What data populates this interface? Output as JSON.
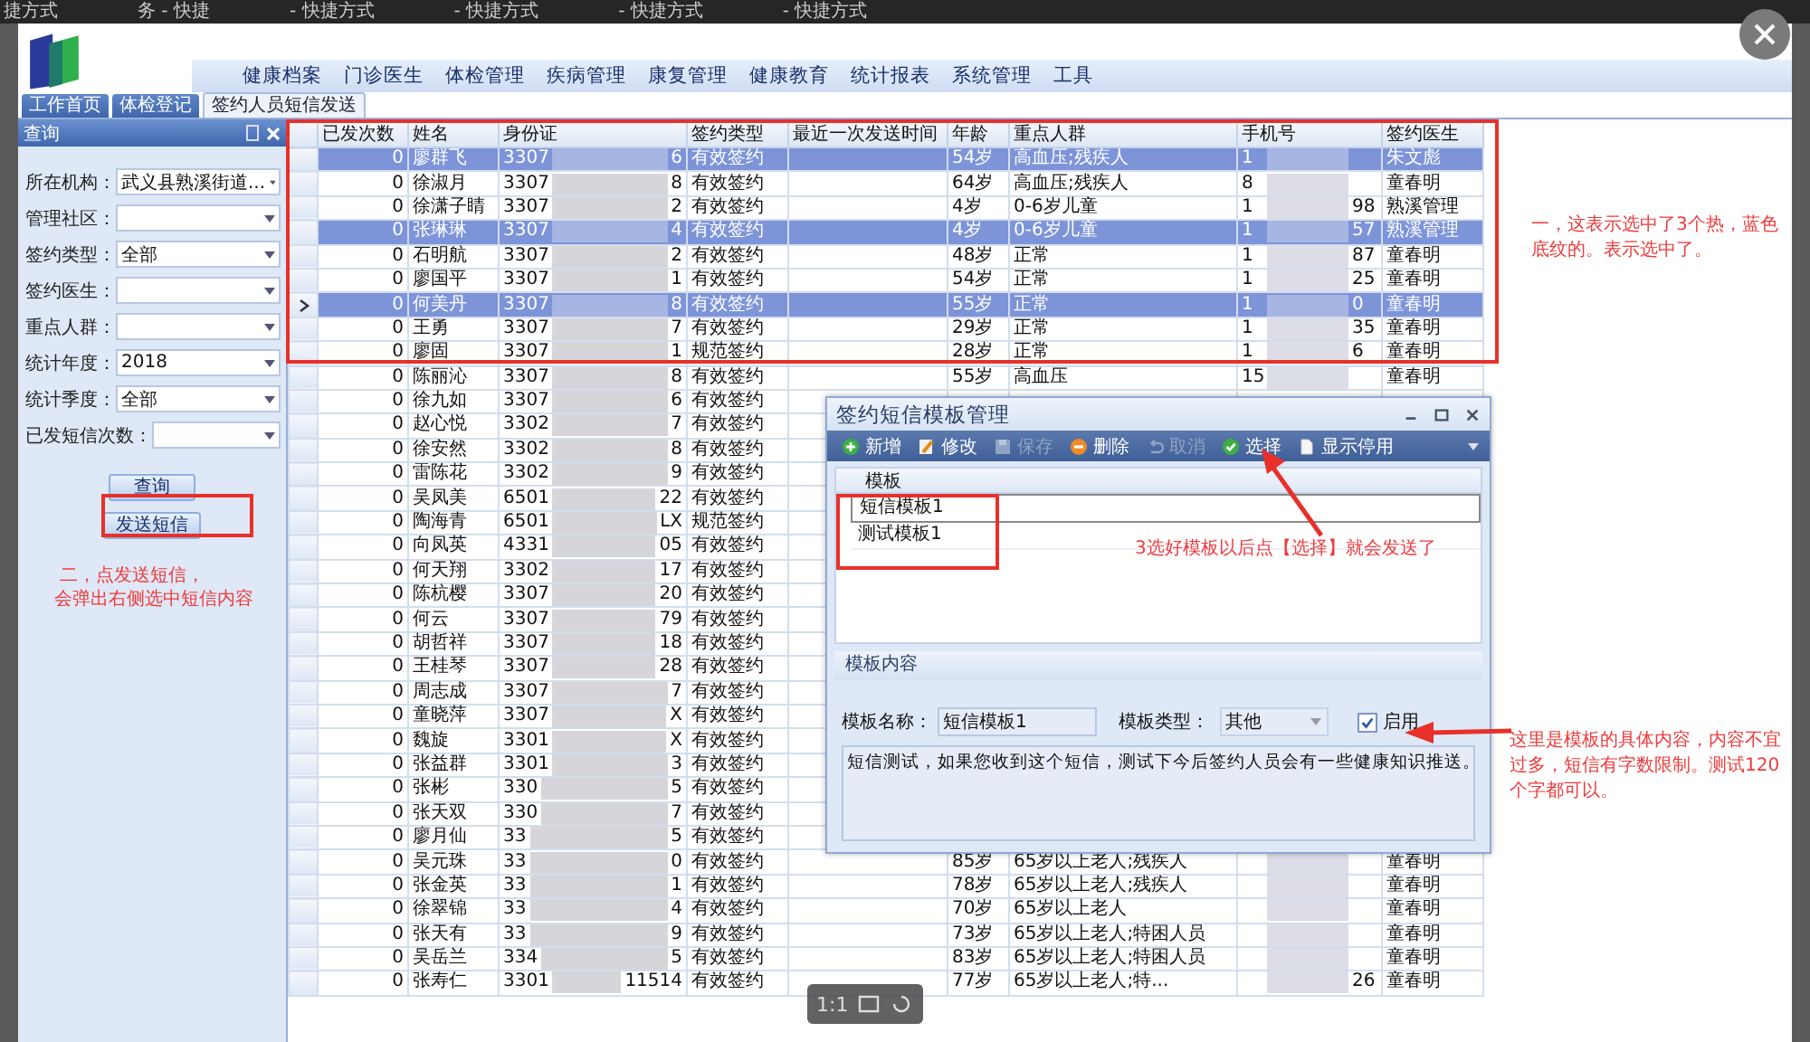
{
  "desktop_strip": [
    "捷方式",
    "务 - 快捷",
    "- 快捷方式",
    "- 快捷方式",
    "- 快捷方式",
    "- 快捷方式"
  ],
  "menu": [
    "健康档案",
    "门诊医生",
    "体检管理",
    "疾病管理",
    "康复管理",
    "健康教育",
    "统计报表",
    "系统管理",
    "工具"
  ],
  "tabs": [
    {
      "label": "工作首页",
      "selected": false
    },
    {
      "label": "体检登记",
      "selected": false
    },
    {
      "label": "签约人员短信发送",
      "selected": true
    }
  ],
  "query_panel": {
    "title": "查询",
    "fields": [
      {
        "label": "所在机构：",
        "value": "武义县熟溪街道..."
      },
      {
        "label": "管理社区："
      },
      {
        "label": "签约类型：",
        "value": "全部"
      },
      {
        "label": "签约医生："
      },
      {
        "label": "重点人群："
      },
      {
        "label": "统计年度：",
        "value": "2018"
      },
      {
        "label": "统计季度：",
        "value": "全部"
      },
      {
        "label": "已发短信次数："
      }
    ],
    "buttons": [
      "查询",
      "发送短信"
    ]
  },
  "table": {
    "columns": [
      "已发次数",
      "姓名",
      "身份证",
      "签约类型",
      "最近一次发送时间",
      "年龄",
      "重点人群",
      "手机号",
      "签约医生"
    ],
    "rows": [
      {
        "sent": "0",
        "name": "廖群飞",
        "id_head": "3307",
        "id_tail": "6",
        "sign_type": "有效签约",
        "age": "54岁",
        "group": "高血压;残疾人",
        "phone_head": "1",
        "doctor": "朱文彪",
        "selected": true,
        "current": false
      },
      {
        "sent": "0",
        "name": "徐淑月",
        "id_head": "3307",
        "id_tail": "8",
        "sign_type": "有效签约",
        "age": "64岁",
        "group": "高血压;残疾人",
        "phone_head": "8",
        "doctor": "童春明",
        "selected": false,
        "current": false
      },
      {
        "sent": "0",
        "name": "徐潇子睛",
        "id_head": "3307",
        "id_tail": "2",
        "sign_type": "有效签约",
        "age": "4岁",
        "group": "0-6岁儿童",
        "phone_head": "1",
        "phone_tail": "98",
        "doctor": "熟溪管理",
        "selected": false,
        "current": false
      },
      {
        "sent": "0",
        "name": "张琳琳",
        "id_head": "3307",
        "id_tail": "4",
        "sign_type": "有效签约",
        "age": "4岁",
        "group": "0-6岁儿童",
        "phone_head": "1",
        "phone_tail": "57",
        "doctor": "熟溪管理",
        "selected": true,
        "current": false
      },
      {
        "sent": "0",
        "name": "石明航",
        "id_head": "3307",
        "id_tail": "2",
        "sign_type": "有效签约",
        "age": "48岁",
        "group": "正常",
        "phone_head": "1",
        "phone_tail": "87",
        "doctor": "童春明",
        "selected": false,
        "current": false
      },
      {
        "sent": "0",
        "name": "廖国平",
        "id_head": "3307",
        "id_tail": "1",
        "sign_type": "有效签约",
        "age": "54岁",
        "group": "正常",
        "phone_head": "1",
        "phone_tail": "25",
        "doctor": "童春明",
        "selected": false,
        "current": false
      },
      {
        "sent": "0",
        "name": "何美丹",
        "id_head": "3307",
        "id_tail": "8",
        "sign_type": "有效签约",
        "age": "55岁",
        "group": "正常",
        "phone_head": "1",
        "phone_tail": "0",
        "doctor": "童春明",
        "selected": true,
        "current": true
      },
      {
        "sent": "0",
        "name": "王勇",
        "id_head": "3307",
        "id_tail": "7",
        "sign_type": "有效签约",
        "age": "29岁",
        "group": "正常",
        "phone_head": "1",
        "phone_tail": "35",
        "doctor": "童春明",
        "selected": false,
        "current": false
      },
      {
        "sent": "0",
        "name": "廖固",
        "id_head": "3307",
        "id_tail": "1",
        "sign_type": "规范签约",
        "age": "28岁",
        "group": "正常",
        "phone_head": "1",
        "phone_tail": "6",
        "doctor": "童春明",
        "selected": false,
        "current": false
      },
      {
        "sent": "0",
        "name": "陈丽沁",
        "id_head": "3307",
        "id_tail": "8",
        "sign_type": "有效签约",
        "age": "55岁",
        "group": "高血压",
        "phone_head": "15",
        "doctor": "童春明",
        "selected": false,
        "current": false
      },
      {
        "sent": "0",
        "name": "徐九如",
        "id_head": "3307",
        "id_tail": "6",
        "sign_type": "有效签约",
        "selected": false,
        "current": false
      },
      {
        "sent": "0",
        "name": "赵心悦",
        "id_head": "3302",
        "id_tail": "7",
        "sign_type": "有效签约",
        "selected": false,
        "current": false
      },
      {
        "sent": "0",
        "name": "徐安然",
        "id_head": "3302",
        "id_tail": "8",
        "sign_type": "有效签约",
        "selected": false,
        "current": false
      },
      {
        "sent": "0",
        "name": "雷陈花",
        "id_head": "3302",
        "id_tail": "9",
        "sign_type": "有效签约",
        "selected": false,
        "current": false
      },
      {
        "sent": "0",
        "name": "吴凤美",
        "id_head": "6501",
        "id_tail": "22",
        "sign_type": "有效签约",
        "selected": false,
        "current": false
      },
      {
        "sent": "0",
        "name": "陶海青",
        "id_head": "6501",
        "id_tail": "LX",
        "sign_type": "规范签约",
        "selected": false,
        "current": false
      },
      {
        "sent": "0",
        "name": "向凤英",
        "id_head": "4331",
        "id_tail": "05",
        "sign_type": "有效签约",
        "selected": false,
        "current": false
      },
      {
        "sent": "0",
        "name": "何天翔",
        "id_head": "3302",
        "id_tail": "17",
        "sign_type": "有效签约",
        "selected": false,
        "current": false
      },
      {
        "sent": "0",
        "name": "陈杭樱",
        "id_head": "3307",
        "id_tail": "20",
        "sign_type": "有效签约",
        "selected": false,
        "current": false
      },
      {
        "sent": "0",
        "name": "何云",
        "id_head": "3307",
        "id_tail": "79",
        "sign_type": "有效签约",
        "selected": false,
        "current": false
      },
      {
        "sent": "0",
        "name": "胡哲祥",
        "id_head": "3307",
        "id_tail": "18",
        "sign_type": "有效签约",
        "selected": false,
        "current": false
      },
      {
        "sent": "0",
        "name": "王桂琴",
        "id_head": "3307",
        "id_tail": "28",
        "sign_type": "有效签约",
        "selected": false,
        "current": false
      },
      {
        "sent": "0",
        "name": "周志成",
        "id_head": "3307",
        "id_tail": "7",
        "sign_type": "有效签约",
        "selected": false,
        "current": false
      },
      {
        "sent": "0",
        "name": "童晓萍",
        "id_head": "3307",
        "id_tail": "X",
        "sign_type": "有效签约",
        "selected": false,
        "current": false
      },
      {
        "sent": "0",
        "name": "魏旋",
        "id_head": "3301",
        "id_tail": "X",
        "sign_type": "有效签约",
        "selected": false,
        "current": false
      },
      {
        "sent": "0",
        "name": "张益群",
        "id_head": "3301",
        "id_tail": "3",
        "sign_type": "有效签约",
        "selected": false,
        "current": false
      },
      {
        "sent": "0",
        "name": "张彬",
        "id_head": "330",
        "id_tail": "5",
        "sign_type": "有效签约",
        "selected": false,
        "current": false
      },
      {
        "sent": "0",
        "name": "张天双",
        "id_head": "330",
        "id_tail": "7",
        "sign_type": "有效签约",
        "selected": false,
        "current": false
      },
      {
        "sent": "0",
        "name": "廖月仙",
        "id_head": "33",
        "id_tail": "5",
        "sign_type": "有效签约",
        "selected": false,
        "current": false
      },
      {
        "sent": "0",
        "name": "吴元珠",
        "id_head": "33",
        "id_tail": "0",
        "sign_type": "有效签约",
        "age": "85岁",
        "group": "65岁以上老人;残疾人",
        "doctor": "童春明",
        "selected": false,
        "current": false
      },
      {
        "sent": "0",
        "name": "张金英",
        "id_head": "33",
        "id_tail": "1",
        "sign_type": "有效签约",
        "age": "78岁",
        "group": "65岁以上老人;残疾人",
        "doctor": "童春明",
        "selected": false,
        "current": false
      },
      {
        "sent": "0",
        "name": "徐翠锦",
        "id_head": "33",
        "id_tail": "4",
        "sign_type": "有效签约",
        "age": "70岁",
        "group": "65岁以上老人",
        "doctor": "童春明",
        "selected": false,
        "current": false
      },
      {
        "sent": "0",
        "name": "张天有",
        "id_head": "33",
        "id_tail": "9",
        "sign_type": "有效签约",
        "age": "73岁",
        "group": "65岁以上老人;特困人员",
        "doctor": "童春明",
        "selected": false,
        "current": false
      },
      {
        "sent": "0",
        "name": "吴岳兰",
        "id_head": "334",
        "id_tail": "5",
        "sign_type": "有效签约",
        "age": "83岁",
        "group": "65岁以上老人;特困人员",
        "doctor": "童春明",
        "selected": false,
        "current": false
      },
      {
        "sent": "0",
        "name": "张寿仁",
        "id_head": "3301",
        "id_tail": "11514",
        "sign_type": "有效签约",
        "age": "77岁",
        "group": "65岁以上老人;特...",
        "phone_tail": "26",
        "doctor": "童春明",
        "selected": false,
        "current": false
      }
    ]
  },
  "dialog": {
    "title": "签约短信模板管理",
    "toolbar": [
      {
        "kind": "add",
        "label": "新增",
        "disabled": false
      },
      {
        "kind": "edit",
        "label": "修改",
        "disabled": false
      },
      {
        "kind": "save",
        "label": "保存",
        "disabled": true
      },
      {
        "kind": "delete",
        "label": "删除",
        "disabled": false
      },
      {
        "kind": "cancel",
        "label": "取消",
        "disabled": true
      },
      {
        "kind": "select",
        "label": "选择",
        "disabled": false
      },
      {
        "kind": "page",
        "label": "显示停用",
        "disabled": false
      }
    ],
    "grid": {
      "column": "模板",
      "rows": [
        {
          "name": "短信模板1",
          "selected": true
        },
        {
          "name": "测试模板1",
          "selected": false
        }
      ]
    },
    "section": "模板内容",
    "name_label": "模板名称：",
    "name_value": "短信模板1",
    "type_label": "模板类型：",
    "type_value": "其他",
    "enable": {
      "label": "启用",
      "checked": true
    },
    "content": "短信测试，如果您收到这个短信，测试下今后签约人员会有一些健康知识推送。"
  },
  "annotations": [
    "一，这表示选中了3个热，蓝色底纹的。表示选中了。",
    "二，点发送短信，",
    "会弹出右侧选中短信内容",
    "3选好模板以后点【选择】就会发送了",
    "这里是模板的具体内容，内容不宜过多，短信有字数限制。测试120个字都可以。"
  ],
  "viewer": {
    "zoom_label": "1:1"
  }
}
